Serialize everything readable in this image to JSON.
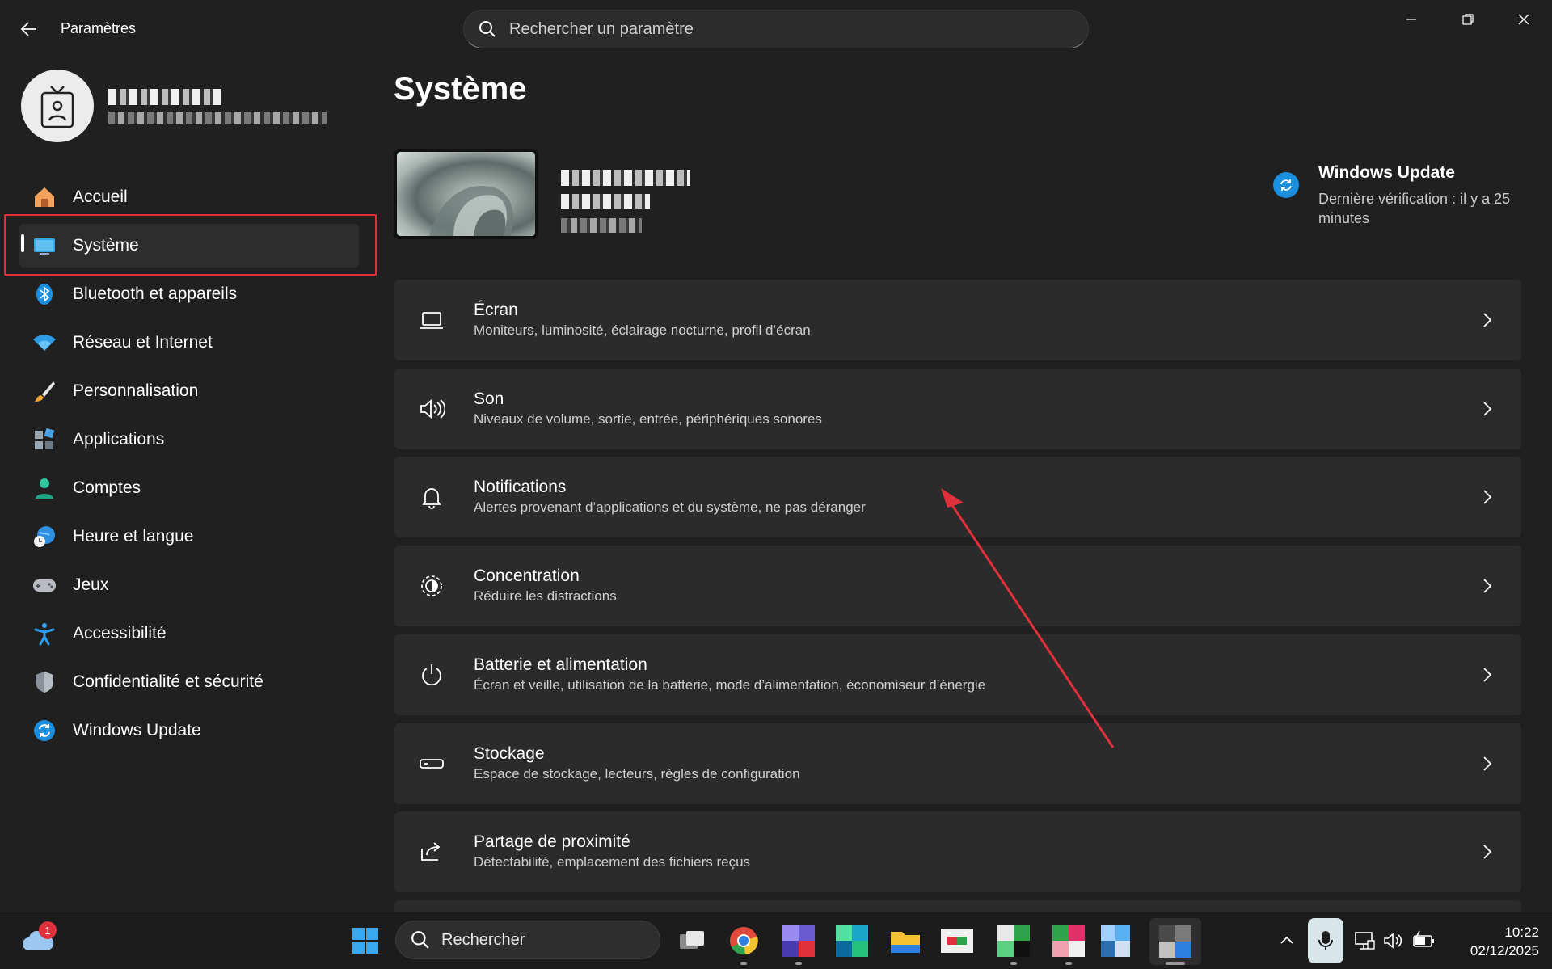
{
  "window": {
    "title": "Paramètres",
    "search_placeholder": "Rechercher un paramètre"
  },
  "sidebar": {
    "items": [
      {
        "label": "Accueil",
        "icon": "home-icon"
      },
      {
        "label": "Système",
        "icon": "display-icon",
        "selected": true
      },
      {
        "label": "Bluetooth et appareils",
        "icon": "bluetooth-icon"
      },
      {
        "label": "Réseau et Internet",
        "icon": "wifi-icon"
      },
      {
        "label": "Personnalisation",
        "icon": "paintbrush-icon"
      },
      {
        "label": "Applications",
        "icon": "apps-icon"
      },
      {
        "label": "Comptes",
        "icon": "person-icon"
      },
      {
        "label": "Heure et langue",
        "icon": "globe-clock-icon"
      },
      {
        "label": "Jeux",
        "icon": "gamepad-icon"
      },
      {
        "label": "Accessibilité",
        "icon": "accessibility-icon"
      },
      {
        "label": "Confidentialité et sécurité",
        "icon": "shield-icon"
      },
      {
        "label": "Windows Update",
        "icon": "update-icon"
      }
    ]
  },
  "main": {
    "title": "Système",
    "windows_update": {
      "title": "Windows Update",
      "subtitle": "Dernière vérification : il y a 25 minutes"
    },
    "cards": [
      {
        "title": "Écran",
        "subtitle": "Moniteurs, luminosité, éclairage nocturne, profil d’écran",
        "icon": "monitor-icon"
      },
      {
        "title": "Son",
        "subtitle": "Niveaux de volume, sortie, entrée, périphériques sonores",
        "icon": "speaker-icon"
      },
      {
        "title": "Notifications",
        "subtitle": "Alertes provenant d’applications et du système, ne pas déranger",
        "icon": "bell-icon"
      },
      {
        "title": "Concentration",
        "subtitle": "Réduire les distractions",
        "icon": "focus-icon"
      },
      {
        "title": "Batterie et alimentation",
        "subtitle": "Écran et veille, utilisation de la batterie, mode d’alimentation, économiseur d’énergie",
        "icon": "power-icon"
      },
      {
        "title": "Stockage",
        "subtitle": "Espace de stockage, lecteurs, règles de configuration",
        "icon": "storage-icon"
      },
      {
        "title": "Partage de proximité",
        "subtitle": "Détectabilité, emplacement des fichiers reçus",
        "icon": "share-icon"
      }
    ]
  },
  "taskbar": {
    "search_label": "Rechercher",
    "weather_badge": "1",
    "time": "10:22",
    "date": "02/12/2025"
  },
  "colors": {
    "background": "#202020",
    "card": "#2b2b2b",
    "accent": "#1a8fe0",
    "annotation": "#e0303c"
  }
}
